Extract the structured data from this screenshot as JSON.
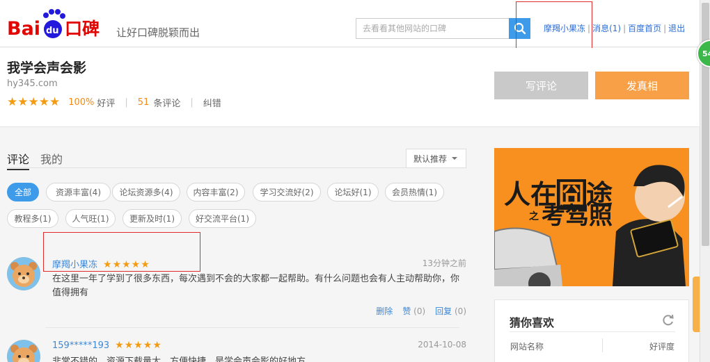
{
  "header": {
    "logo_text": "Baidu口碑",
    "slogan": "让好口碑脱颖而出",
    "search_placeholder": "去看看其他网站的口碑",
    "user_name": "摩羯小果冻",
    "messages_label": "消息(1)",
    "home_label": "百度首页",
    "logout_label": "退出"
  },
  "site": {
    "title": "我学会声会影",
    "url": "hy345.com",
    "stars": "★★★★★",
    "good_rate": "100%",
    "good_label": "好评",
    "review_count": "51",
    "review_label": "条评论",
    "correct_label": "纠错",
    "write_button": "写评论",
    "fact_button": "发真相"
  },
  "tabs": {
    "comments": "评论",
    "mine": "我的",
    "sort_label": "默认推荐"
  },
  "tags": [
    "全部",
    "资源丰富(4)",
    "论坛资源多(4)",
    "内容丰富(2)",
    "学习交流好(2)",
    "论坛好(1)",
    "会员热情(1)",
    "教程多(1)",
    "人气旺(1)",
    "更新及时(1)",
    "好交流平台(1)"
  ],
  "reviews": [
    {
      "name": "摩羯小果冻",
      "stars": "★★★★★",
      "time": "13分钟之前",
      "text": "在这里一年了学到了很多东西，每次遇到不会的大家都一起帮助。有什么问题也会有人主动帮助你，你值得拥有",
      "delete_label": "删除",
      "like_label": "赞",
      "like_count": "(0)",
      "reply_label": "回复",
      "reply_count": "(0)"
    },
    {
      "name": "159*****193",
      "stars": "★★★★★",
      "time": "2014-10-08",
      "text": "非常不错的，资源下载量大，方便快捷，是学会声会影的好地方"
    }
  ],
  "banner": {
    "text_1": "人在",
    "text_2": "囧",
    "text_3": "途",
    "text_4": "之",
    "text_5": "考驾照"
  },
  "likes": {
    "title": "猜你喜欢",
    "col_site": "网站名称",
    "col_good": "好评度"
  },
  "float_badge": "54",
  "colors": {
    "brand_red": "#e10602",
    "brand_blue": "#2319dc",
    "accent_blue": "#3e9bea",
    "orange": "#f8a048",
    "star": "#f39c12"
  }
}
